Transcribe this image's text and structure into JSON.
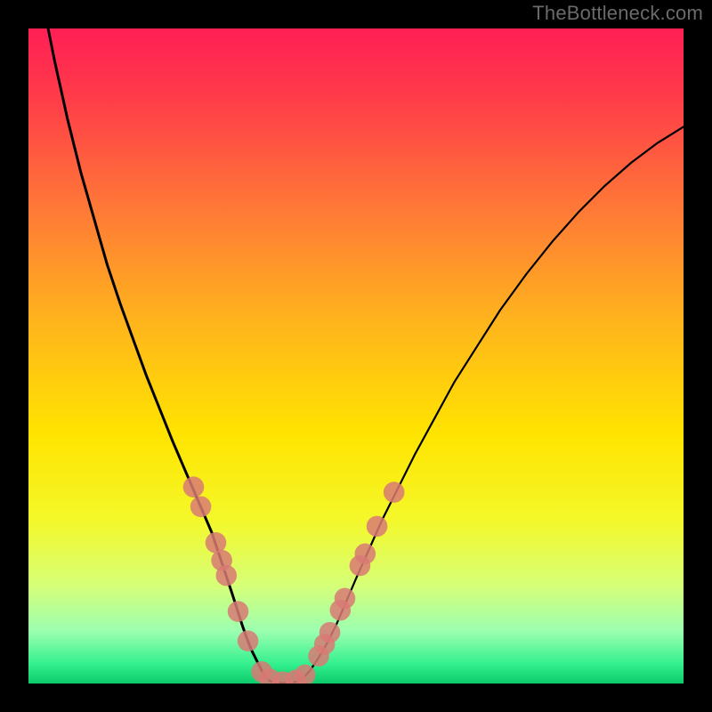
{
  "watermark": "TheBottleneck.com",
  "chart_data": {
    "type": "line",
    "title": "",
    "xlabel": "",
    "ylabel": "",
    "xlim": [
      0,
      100
    ],
    "ylim": [
      0,
      100
    ],
    "background_gradient": {
      "stops": [
        {
          "pos": 0.0,
          "color": "#ff1f55"
        },
        {
          "pos": 0.1,
          "color": "#ff3a4a"
        },
        {
          "pos": 0.28,
          "color": "#ff7a36"
        },
        {
          "pos": 0.45,
          "color": "#ffb51c"
        },
        {
          "pos": 0.62,
          "color": "#ffe400"
        },
        {
          "pos": 0.75,
          "color": "#f4f82a"
        },
        {
          "pos": 0.85,
          "color": "#d6ff77"
        },
        {
          "pos": 0.92,
          "color": "#9cffb0"
        },
        {
          "pos": 0.97,
          "color": "#34f08e"
        },
        {
          "pos": 1.0,
          "color": "#0cca6b"
        }
      ]
    },
    "series": [
      {
        "name": "left-branch",
        "x": [
          3,
          4,
          6,
          8,
          10,
          12,
          14,
          16,
          18,
          20,
          22,
          23.5,
          25,
          26.5,
          28,
          29,
          30,
          31,
          31.8,
          32.6,
          33.3,
          34,
          34.7,
          35.3,
          35.8,
          36.2
        ],
        "y": [
          100,
          95,
          86,
          78,
          71,
          64,
          58,
          52.5,
          47,
          42,
          37,
          33.5,
          30,
          26.5,
          23,
          20,
          17,
          14,
          11.5,
          9,
          7,
          5.2,
          3.8,
          2.6,
          1.6,
          0.9
        ]
      },
      {
        "name": "valley",
        "x": [
          36.2,
          37,
          38,
          39,
          40,
          41,
          42
        ],
        "y": [
          0.9,
          0.3,
          0.1,
          0.1,
          0.1,
          0.3,
          0.9
        ]
      },
      {
        "name": "right-branch",
        "x": [
          42,
          43,
          44.2,
          45.5,
          47,
          48.5,
          50,
          52,
          54,
          56.5,
          59,
          62,
          65,
          68.5,
          72,
          76,
          80,
          84,
          88,
          92,
          96,
          100
        ],
        "y": [
          0.9,
          2,
          3.8,
          6,
          9,
          12.5,
          16,
          20.5,
          25,
          30,
          35,
          40.5,
          46,
          51.5,
          57,
          62.5,
          67.5,
          72,
          76,
          79.5,
          82.5,
          85
        ]
      }
    ],
    "markers": [
      {
        "x": 25.2,
        "y": 30.0
      },
      {
        "x": 26.3,
        "y": 27.0
      },
      {
        "x": 28.6,
        "y": 21.5
      },
      {
        "x": 29.5,
        "y": 18.8
      },
      {
        "x": 30.2,
        "y": 16.5
      },
      {
        "x": 32.0,
        "y": 11.0
      },
      {
        "x": 33.5,
        "y": 6.5
      },
      {
        "x": 35.6,
        "y": 1.8
      },
      {
        "x": 36.8,
        "y": 0.7
      },
      {
        "x": 38.8,
        "y": 0.25
      },
      {
        "x": 40.8,
        "y": 0.5
      },
      {
        "x": 42.2,
        "y": 1.3
      },
      {
        "x": 44.3,
        "y": 4.2
      },
      {
        "x": 45.2,
        "y": 6.0
      },
      {
        "x": 46.0,
        "y": 7.8
      },
      {
        "x": 47.6,
        "y": 11.2
      },
      {
        "x": 48.3,
        "y": 13.0
      },
      {
        "x": 50.6,
        "y": 18.0
      },
      {
        "x": 51.4,
        "y": 19.8
      },
      {
        "x": 53.2,
        "y": 24.0
      },
      {
        "x": 55.8,
        "y": 29.2
      }
    ],
    "marker_radius_x": 1.6
  }
}
